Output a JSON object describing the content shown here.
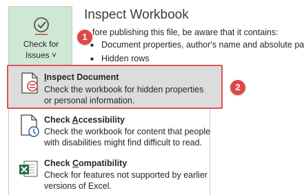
{
  "check_for_issues": {
    "line1": "Check for",
    "line2": "Issues",
    "caret": "˅"
  },
  "inspect_workbook": {
    "title": "Inspect Workbook",
    "intro": "fore publishing this file, be aware that it contains:",
    "bullets": [
      "Document properties, author's name and absolute path",
      "Hidden rows"
    ]
  },
  "menu": {
    "items": [
      {
        "title_pre": "",
        "title_ul": "I",
        "title_post": "nspect Document",
        "desc1": "Check the workbook for hidden properties",
        "desc2": "or personal information."
      },
      {
        "title_pre": "Check ",
        "title_ul": "A",
        "title_post": "ccessibility",
        "desc1": "Check the workbook for content that people",
        "desc2": "with disabilities might find difficult to read."
      },
      {
        "title_pre": "Check ",
        "title_ul": "C",
        "title_post": "ompatibility",
        "desc1": "Check for features not supported by earlier",
        "desc2": "versions of Excel."
      }
    ]
  },
  "badges": [
    "1",
    "2"
  ],
  "colors": {
    "button_bg": "#cfe8d4",
    "highlight_bg": "#dcdcdc",
    "annotation_red": "#e04848"
  }
}
